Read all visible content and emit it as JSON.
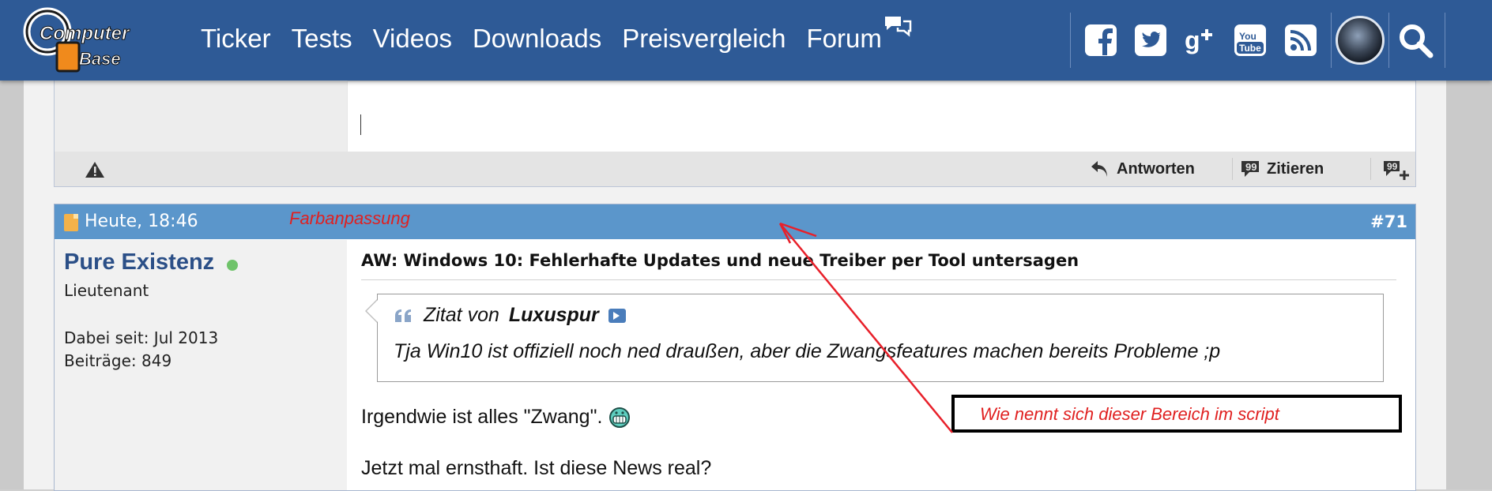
{
  "header": {
    "logo": {
      "line1": "Computer",
      "line2": "Base"
    },
    "nav": [
      "Ticker",
      "Tests",
      "Videos",
      "Downloads",
      "Preisvergleich",
      "Forum"
    ],
    "social_icons": [
      "facebook-icon",
      "twitter-icon",
      "google-plus-icon",
      "youtube-icon",
      "rss-icon"
    ]
  },
  "prev_post": {
    "actions": {
      "reply": "Antworten",
      "quote": "Zitieren"
    }
  },
  "post": {
    "date": "Heute, 18:46",
    "number": "#71",
    "user": {
      "name": "Pure Existenz",
      "rank": "Lieutenant",
      "joined": "Dabei seit: Jul 2013",
      "posts": "Beiträge: 849"
    },
    "title": "AW: Windows 10: Fehlerhafte Updates und neue Treiber per Tool untersagen",
    "quote": {
      "prefix": "Zitat von",
      "author": "Luxuspur",
      "text": "Tja Win10 ist offiziell noch ned draußen, aber die Zwangsfeatures machen bereits Probleme ;p"
    },
    "paragraphs": [
      "Irgendwie ist alles \"Zwang\".",
      "Jetzt mal ernsthaft. Ist diese News real?"
    ]
  },
  "annotations": {
    "label1": "Farbanpassung",
    "label2": "Wie nennt sich dieser Bereich im script"
  },
  "colors": {
    "header_bg": "#2e5a96",
    "post_header_bg": "#5b96cb",
    "username": "#2b4f87",
    "annotation": "#e02020",
    "online": "#6fc36a"
  }
}
